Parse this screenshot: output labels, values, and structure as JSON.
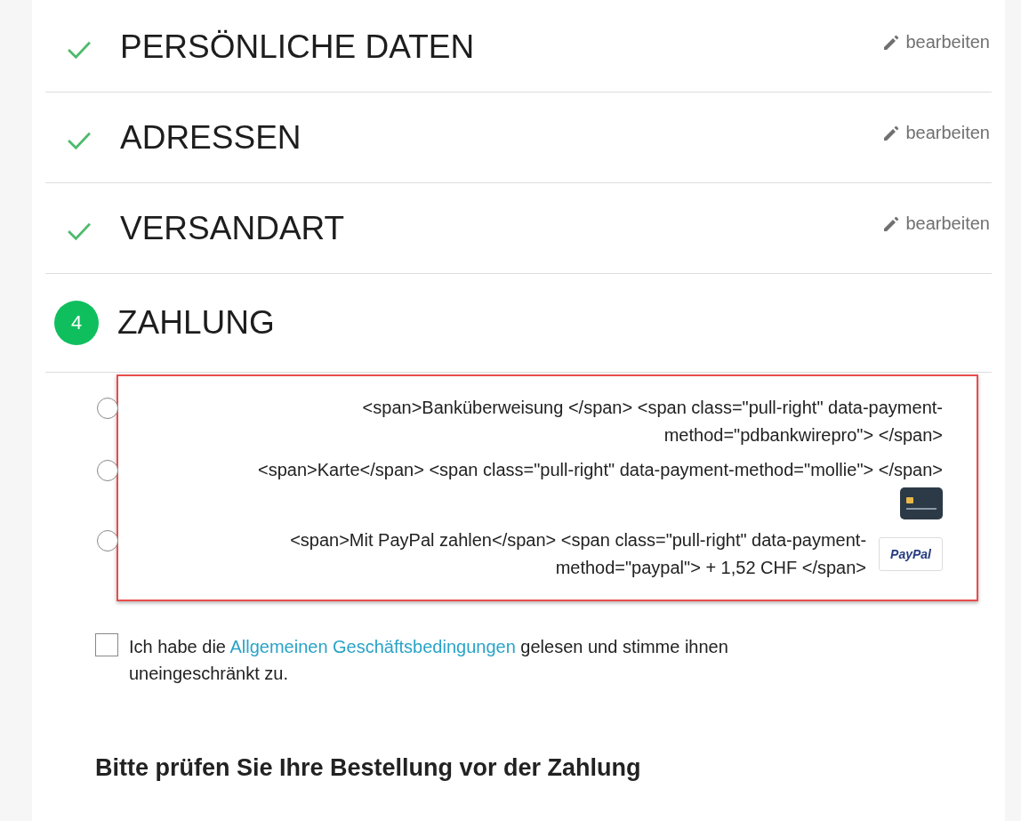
{
  "steps": [
    {
      "kind": "done",
      "title": "PERSÖNLICHE DATEN",
      "edit": "bearbeiten"
    },
    {
      "kind": "done",
      "title": "ADRESSEN",
      "edit": "bearbeiten"
    },
    {
      "kind": "done",
      "title": "VERSANDART",
      "edit": "bearbeiten"
    },
    {
      "kind": "current",
      "number": "4",
      "title": "ZAHLUNG"
    }
  ],
  "payment_options": [
    {
      "label": "<span>Banküberweisung </span> <span class=\"pull-right\" data-payment-method=\"pdbankwirepro\"> </span>",
      "selected": false
    },
    {
      "label": "<span>Karte</span> <span class=\"pull-right\" data-payment-method=\"mollie\"> </span>",
      "selected": false,
      "kind": "card"
    },
    {
      "label": "<span>Mit PayPal zahlen</span> <span class=\"pull-right\" data-payment-method=\"paypal\"> + 1,52 CHF </span>",
      "selected": false,
      "kind": "paypal",
      "logo_text": "PayPal"
    }
  ],
  "terms": {
    "checked": false,
    "before": "Ich habe die",
    "link": "Allgemeinen Geschäftsbedingungen",
    "after": "gelesen und stimme ihnen uneingeschränkt zu."
  },
  "review_heading": "Bitte prüfen Sie Ihre Bestellung vor der Zahlung"
}
